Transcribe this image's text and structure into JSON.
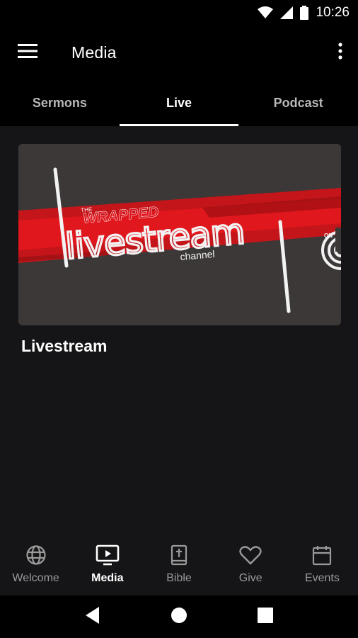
{
  "status_bar": {
    "time": "10:26",
    "icons": [
      "wifi-icon",
      "signal-icon",
      "battery-icon"
    ]
  },
  "app_bar": {
    "title": "Media",
    "menu_icon": "menu-icon",
    "more_icon": "more-vert-icon"
  },
  "tabs": [
    {
      "label": "Sermons",
      "active": false
    },
    {
      "label": "Live",
      "active": true
    },
    {
      "label": "Podcast",
      "active": false
    }
  ],
  "media_item": {
    "title": "Livestream",
    "thumbnail": {
      "brand_small": "THE",
      "brand": "WRAPPED",
      "headline": "livestream",
      "subline": "channel",
      "badge": "ON"
    }
  },
  "bottom_nav": [
    {
      "label": "Welcome",
      "icon": "globe-icon",
      "active": false
    },
    {
      "label": "Media",
      "icon": "tv-play-icon",
      "active": true
    },
    {
      "label": "Bible",
      "icon": "bible-icon",
      "active": false
    },
    {
      "label": "Give",
      "icon": "heart-icon",
      "active": false
    },
    {
      "label": "Events",
      "icon": "calendar-icon",
      "active": false
    }
  ],
  "system_nav": [
    "back-icon",
    "home-icon",
    "recents-icon"
  ],
  "colors": {
    "background": "#151517",
    "bar": "#000000",
    "accent_red": "#d9141b",
    "tab_inactive": "#b8b8b8",
    "nav_inactive": "#9a9a9a"
  }
}
